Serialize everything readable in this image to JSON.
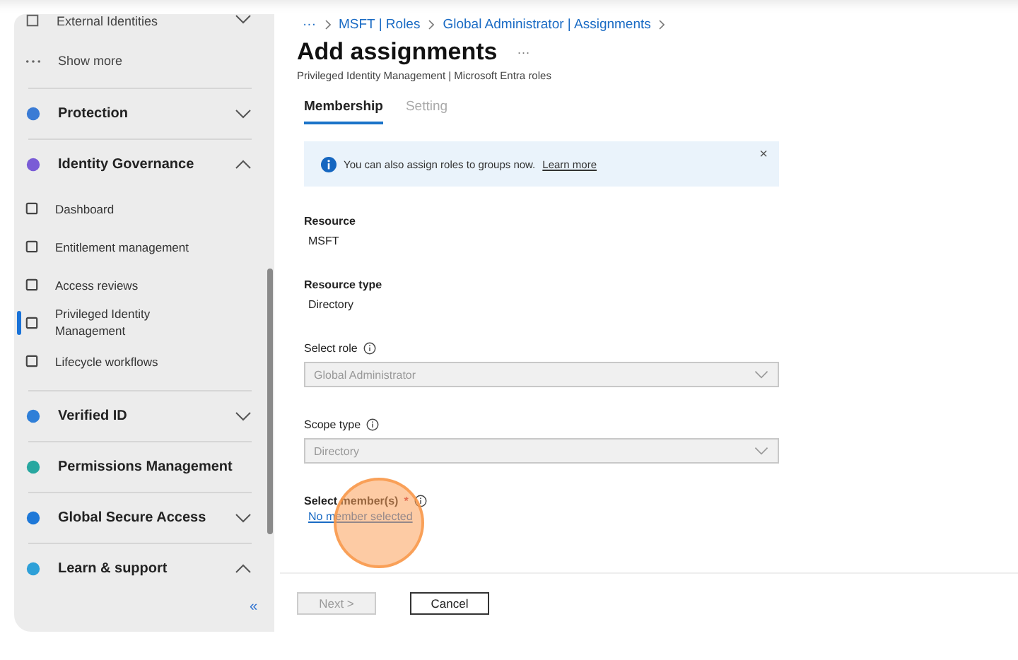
{
  "sidebar": {
    "items": [
      {
        "kind": "item",
        "label": "External Identities",
        "expanded": false
      },
      {
        "kind": "more",
        "label": "Show more"
      },
      {
        "kind": "section",
        "label": "Protection",
        "expanded": false
      },
      {
        "kind": "section",
        "label": "Identity Governance",
        "expanded": true,
        "children": [
          {
            "label": "Dashboard",
            "selected": false
          },
          {
            "label": "Entitlement management",
            "selected": false
          },
          {
            "label": "Access reviews",
            "selected": false
          },
          {
            "label": "Privileged Identity Management",
            "selected": true
          },
          {
            "label": "Lifecycle workflows",
            "selected": false
          }
        ]
      },
      {
        "kind": "section",
        "label": "Verified ID",
        "expanded": false
      },
      {
        "kind": "section",
        "label": "Permissions Management"
      },
      {
        "kind": "section",
        "label": "Global Secure Access",
        "expanded": false
      },
      {
        "kind": "section",
        "label": "Learn & support",
        "expanded": true
      }
    ],
    "collapse": "«"
  },
  "breadcrumb": {
    "more": "···",
    "items": [
      "MSFT | Roles",
      "Global Administrator | Assignments"
    ]
  },
  "page": {
    "title": "Add assignments",
    "more": "···",
    "subtitle": "Privileged Identity Management | Microsoft Entra roles"
  },
  "tabs": [
    {
      "label": "Membership",
      "selected": true
    },
    {
      "label": "Setting",
      "selected": false
    }
  ],
  "banner": {
    "text": "You can also assign roles to groups now.",
    "link": "Learn more",
    "close": "×"
  },
  "fields": [
    {
      "kind": "static",
      "label": "Resource",
      "value": "MSFT"
    },
    {
      "kind": "static",
      "label": "Resource type",
      "value": "Directory"
    },
    {
      "kind": "dropdown",
      "label": "Select role",
      "info": true,
      "value": "Global Administrator",
      "disabled": true
    },
    {
      "kind": "dropdown",
      "label": "Scope type",
      "info": true,
      "value": "Directory",
      "disabled": true
    },
    {
      "kind": "link",
      "label": "Select member(s)",
      "required": "*",
      "info": true,
      "value": "No member selected"
    }
  ],
  "buttons": [
    {
      "label": "Next >",
      "disabled": true
    },
    {
      "label": "Cancel",
      "disabled": false
    }
  ],
  "click_highlight": true
}
